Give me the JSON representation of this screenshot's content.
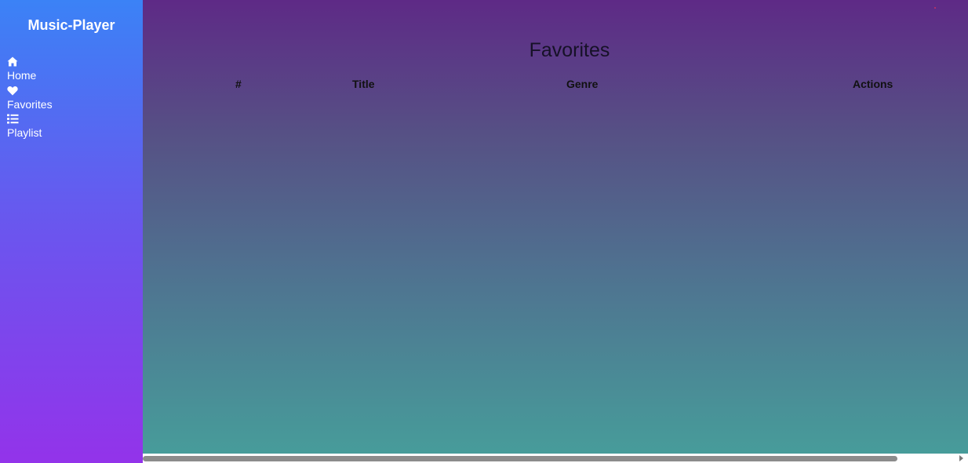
{
  "app": {
    "brand": "Music-Player"
  },
  "sidebar": {
    "items": [
      {
        "label": "Home",
        "icon": "home-icon"
      },
      {
        "label": "Favorites",
        "icon": "heart-icon"
      },
      {
        "label": "Playlist",
        "icon": "list-icon"
      }
    ]
  },
  "main": {
    "title": "Favorites",
    "table": {
      "columns": [
        "#",
        "Title",
        "Genre",
        "Actions"
      ],
      "rows": []
    }
  },
  "colors": {
    "sidebar_top": "#3b82f6",
    "sidebar_bottom": "#9333ea",
    "main_top": "#5e2a86",
    "main_bottom": "#479c9a"
  }
}
